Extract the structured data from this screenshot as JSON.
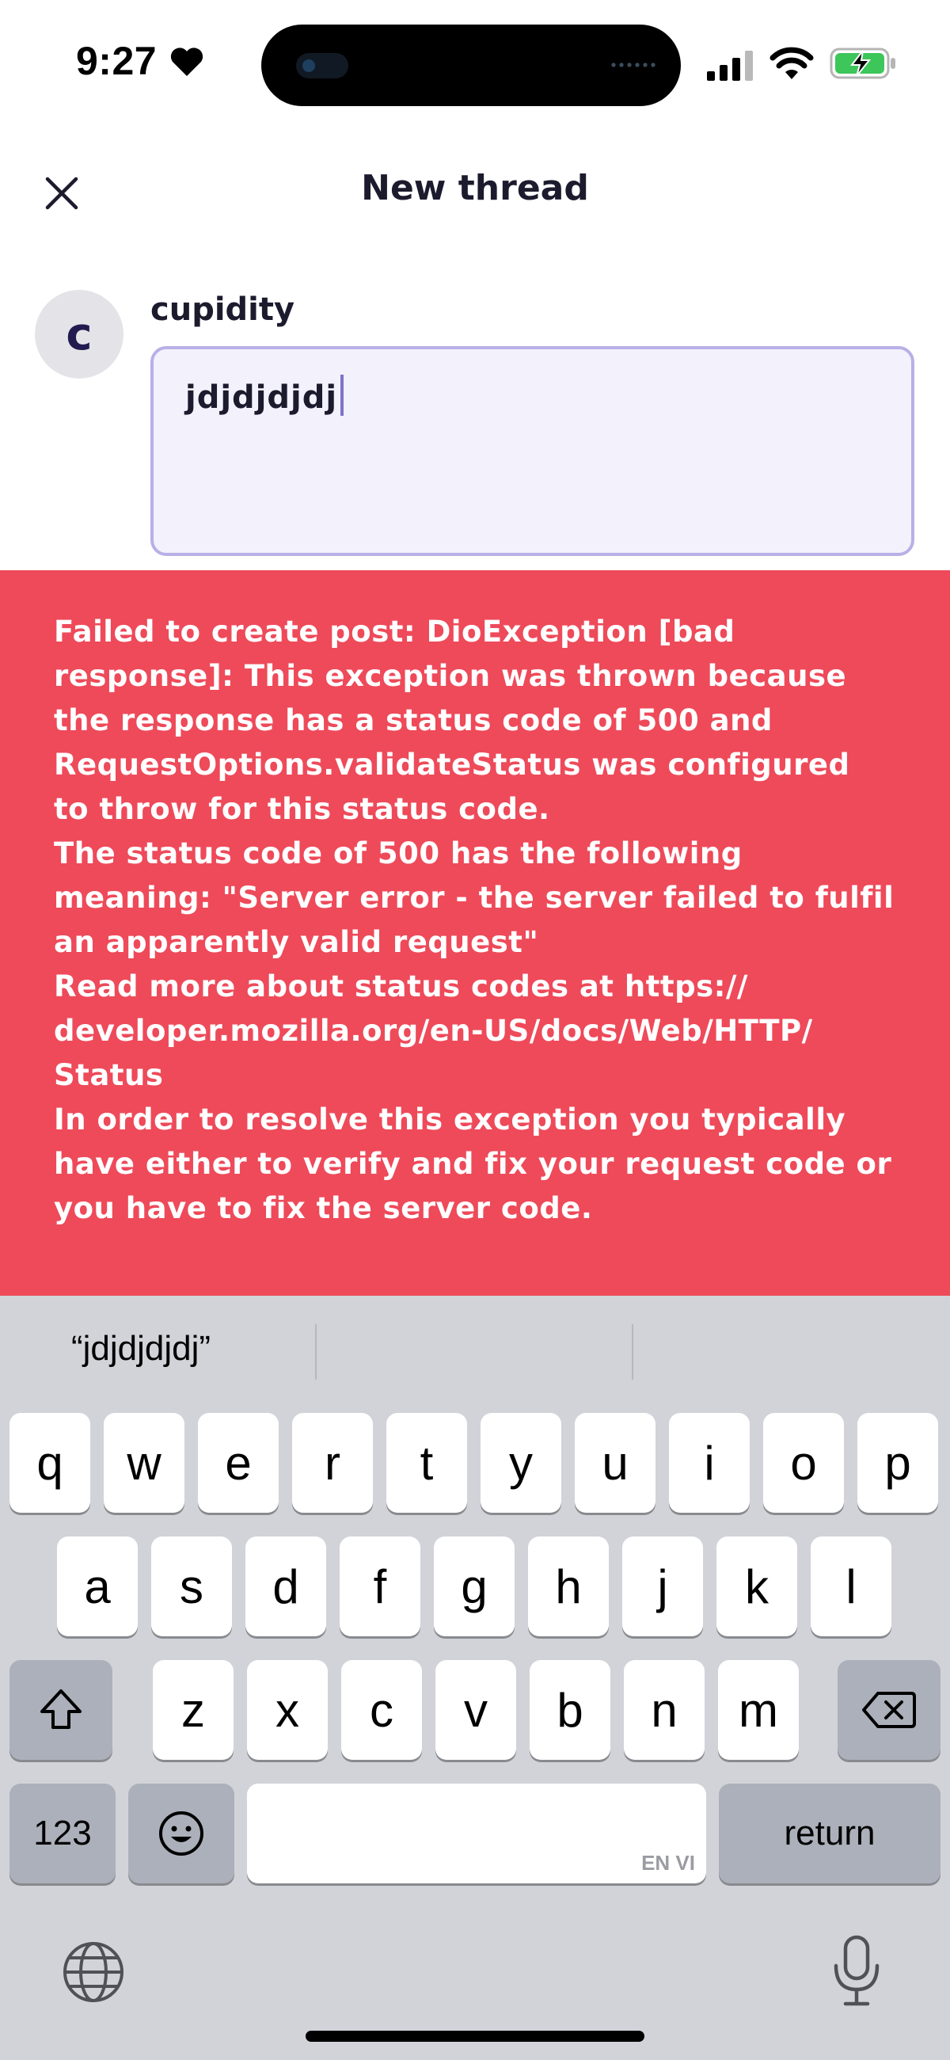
{
  "status_bar": {
    "time": "9:27"
  },
  "header": {
    "title": "New thread"
  },
  "composer": {
    "avatar_initial": "c",
    "username": "cupidity",
    "text": "jdjdjdjdj"
  },
  "error": {
    "message": "Failed to create post: DioException [bad\nresponse]: This exception was thrown because\nthe response has a status code of 500 and\nRequestOptions.validateStatus was configured\nto throw for this status code.\nThe status code of 500 has the following\nmeaning: \"Server error - the server failed to fulfil\nan apparently valid request\"\nRead more about status codes at https://\ndeveloper.mozilla.org/en-US/docs/Web/HTTP/\nStatus\nIn order to resolve this exception you typically\nhave either to verify and fix your request code or\nyou have to fix the server code.",
    "background_color": "#ee4a5a"
  },
  "keyboard": {
    "suggestions": [
      "“jdjdjdjdj”",
      "",
      ""
    ],
    "row1": [
      "q",
      "w",
      "e",
      "r",
      "t",
      "y",
      "u",
      "i",
      "o",
      "p"
    ],
    "row2": [
      "a",
      "s",
      "d",
      "f",
      "g",
      "h",
      "j",
      "k",
      "l"
    ],
    "row3": [
      "z",
      "x",
      "c",
      "v",
      "b",
      "n",
      "m"
    ],
    "numbers_label": "123",
    "return_label": "return",
    "space_language_tag": "EN VI",
    "icons": [
      "shift-icon",
      "backspace-icon",
      "emoji-icon",
      "globe-icon",
      "microphone-icon"
    ]
  }
}
